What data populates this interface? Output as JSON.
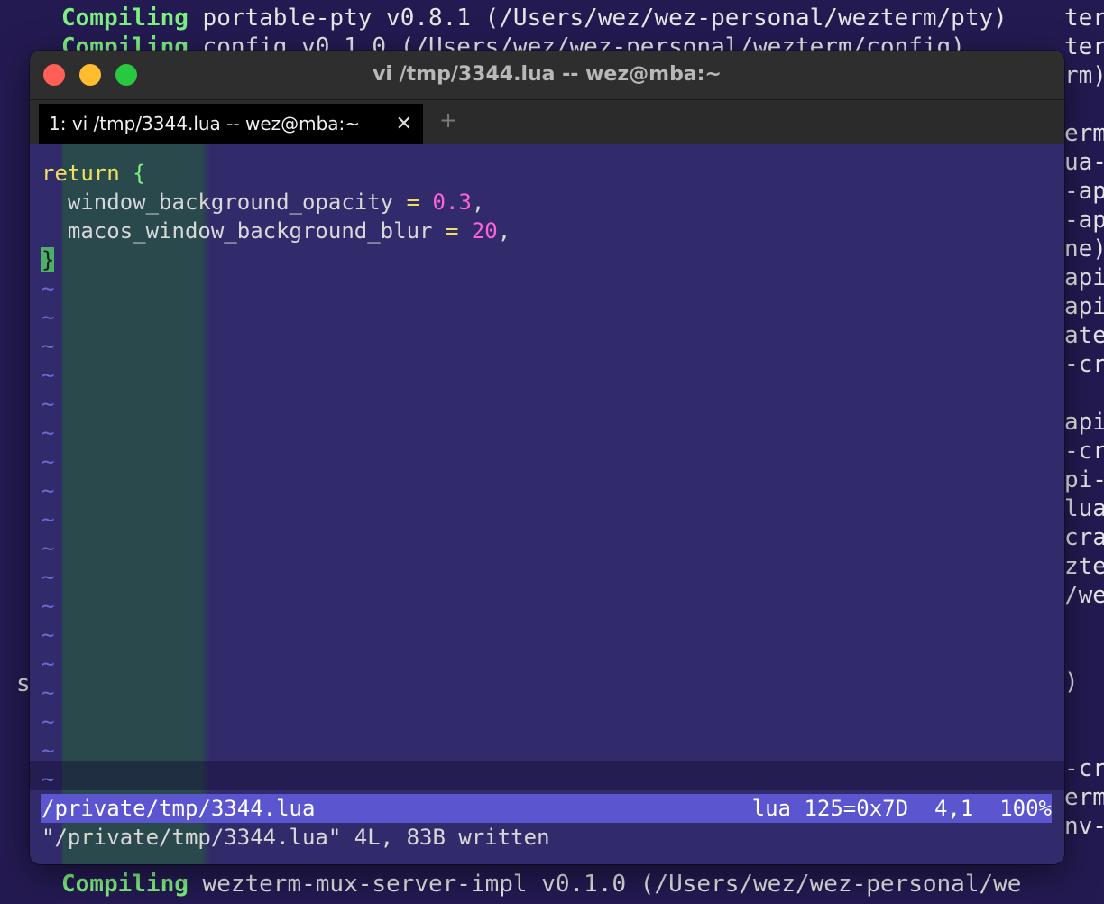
{
  "background_terminal": {
    "top_lines": [
      {
        "keyword": "Compiling",
        "text": " portable-pty v0.8.1 (/Users/wez/wez-personal/wezterm/pty)"
      },
      {
        "keyword": "Compiling",
        "text": " config v0.1.0 (/Users/wez/wez-personal/wezterm/config)"
      }
    ],
    "bottom_line": {
      "keyword": "Compiling",
      "text": " wezterm-mux-server-impl v0.1.0 (/Users/wez/wez-personal/we"
    },
    "right_fragments": [
      "ter",
      "ter",
      "rm)",
      "",
      "erm",
      "ua-",
      "-ap",
      "-ap",
      "ne)",
      "api",
      "api",
      "ate",
      "-cr",
      "",
      "api",
      "-cr",
      "pi-",
      "lua",
      "cra",
      "zte",
      "/we",
      "",
      "",
      ")",
      "",
      "",
      "-cr",
      "erm",
      "nv-"
    ],
    "left_fragment": "s"
  },
  "window": {
    "title": "vi /tmp/3344.lua -- wez@mba:~",
    "tab_label": "1: vi /tmp/3344.lua -- wez@mba:~",
    "tab_close": "✕",
    "new_tab": "+"
  },
  "editor": {
    "line1_kw": "return",
    "line1_brace": "{",
    "line2_key": "  window_background_opacity",
    "line2_op": "=",
    "line2_val": "0.3",
    "line2_end": ",",
    "line3_key": "  macos_window_background_blur",
    "line3_op": "=",
    "line3_val": "20",
    "line3_end": ",",
    "line4_cursor": "}",
    "tilde": "~",
    "status_file": "/private/tmp/3344.lua",
    "status_right": "lua 125=0x7D  4,1  100%",
    "message": "\"/private/tmp/3344.lua\" 4L, 83B written"
  },
  "colors": {
    "background": "#241a52",
    "statusline": "#5b55cf",
    "keyword": "#f0e060",
    "number": "#ff62d8",
    "brace": "#7ef07e",
    "cursor": "#4caf6a",
    "tilde": "#6a6ad0"
  }
}
